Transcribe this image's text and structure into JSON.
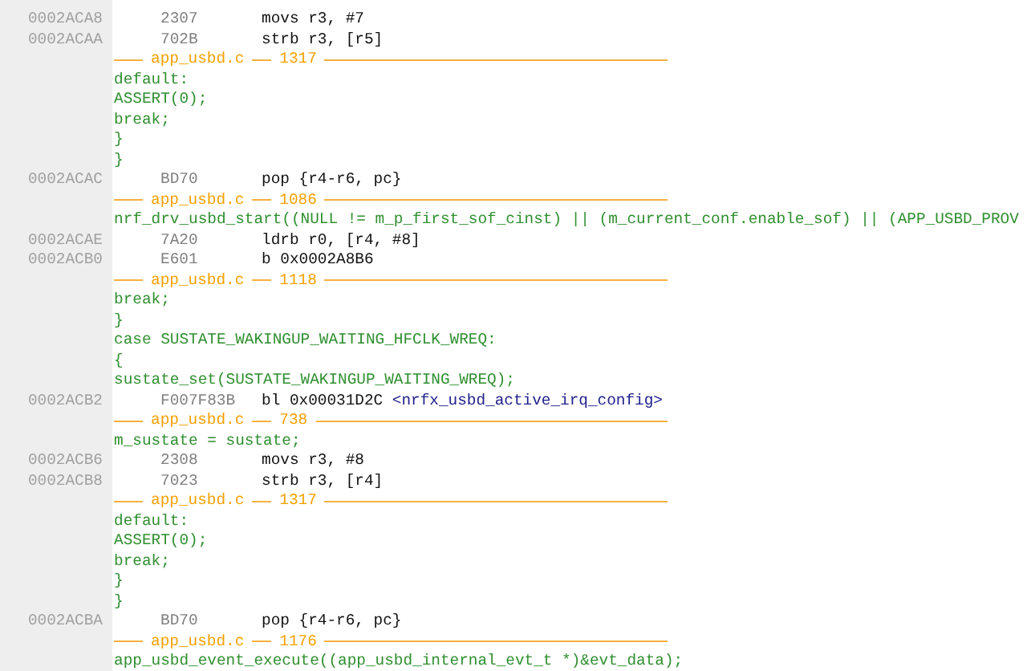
{
  "listing": [
    {
      "kind": "asm",
      "address": "0002ACA8",
      "bytes": "2307",
      "instruction": "movs r3, #7"
    },
    {
      "kind": "asm",
      "address": "0002ACAA",
      "bytes": "702B",
      "instruction": "strb r3, [r5]"
    },
    {
      "kind": "file",
      "file": "app_usbd.c",
      "line": "1317"
    },
    {
      "kind": "source",
      "text": "default:"
    },
    {
      "kind": "source",
      "text": "ASSERT(0);"
    },
    {
      "kind": "source",
      "text": "break;"
    },
    {
      "kind": "source",
      "text": "}"
    },
    {
      "kind": "source",
      "text": "}"
    },
    {
      "kind": "asm",
      "address": "0002ACAC",
      "bytes": "BD70",
      "instruction": "pop {r4-r6, pc}"
    },
    {
      "kind": "file",
      "file": "app_usbd.c",
      "line": "1086"
    },
    {
      "kind": "source",
      "text": "nrf_drv_usbd_start((NULL != m_p_first_sof_cinst) || (m_current_conf.enable_sof) || (APP_USBD_PROV"
    },
    {
      "kind": "asm",
      "address": "0002ACAE",
      "bytes": "7A20",
      "instruction": "ldrb r0, [r4, #8]"
    },
    {
      "kind": "asm",
      "address": "0002ACB0",
      "bytes": "E601",
      "instruction": "b 0x0002A8B6"
    },
    {
      "kind": "file",
      "file": "app_usbd.c",
      "line": "1118"
    },
    {
      "kind": "source",
      "text": "break;"
    },
    {
      "kind": "source",
      "text": "}"
    },
    {
      "kind": "source",
      "text": "case SUSTATE_WAKINGUP_WAITING_HFCLK_WREQ:"
    },
    {
      "kind": "source",
      "text": "{"
    },
    {
      "kind": "source",
      "text": "sustate_set(SUSTATE_WAKINGUP_WAITING_WREQ);"
    },
    {
      "kind": "asm",
      "address": "0002ACB2",
      "bytes": "F007F83B",
      "instruction": "bl 0x00031D2C",
      "symbol": "<nrfx_usbd_active_irq_config>"
    },
    {
      "kind": "file",
      "file": "app_usbd.c",
      "line": "738"
    },
    {
      "kind": "source",
      "text": "m_sustate = sustate;"
    },
    {
      "kind": "asm",
      "address": "0002ACB6",
      "bytes": "2308",
      "instruction": "movs r3, #8"
    },
    {
      "kind": "asm",
      "address": "0002ACB8",
      "bytes": "7023",
      "instruction": "strb r3, [r4]"
    },
    {
      "kind": "file",
      "file": "app_usbd.c",
      "line": "1317"
    },
    {
      "kind": "source",
      "text": "default:"
    },
    {
      "kind": "source",
      "text": "ASSERT(0);"
    },
    {
      "kind": "source",
      "text": "break;"
    },
    {
      "kind": "source",
      "text": "}"
    },
    {
      "kind": "source",
      "text": "}"
    },
    {
      "kind": "asm",
      "address": "0002ACBA",
      "bytes": "BD70",
      "instruction": "pop {r4-r6, pc}"
    },
    {
      "kind": "file",
      "file": "app_usbd.c",
      "line": "1176"
    },
    {
      "kind": "source",
      "text": "app_usbd_event_execute((app_usbd_internal_evt_t *)&evt_data);"
    }
  ]
}
